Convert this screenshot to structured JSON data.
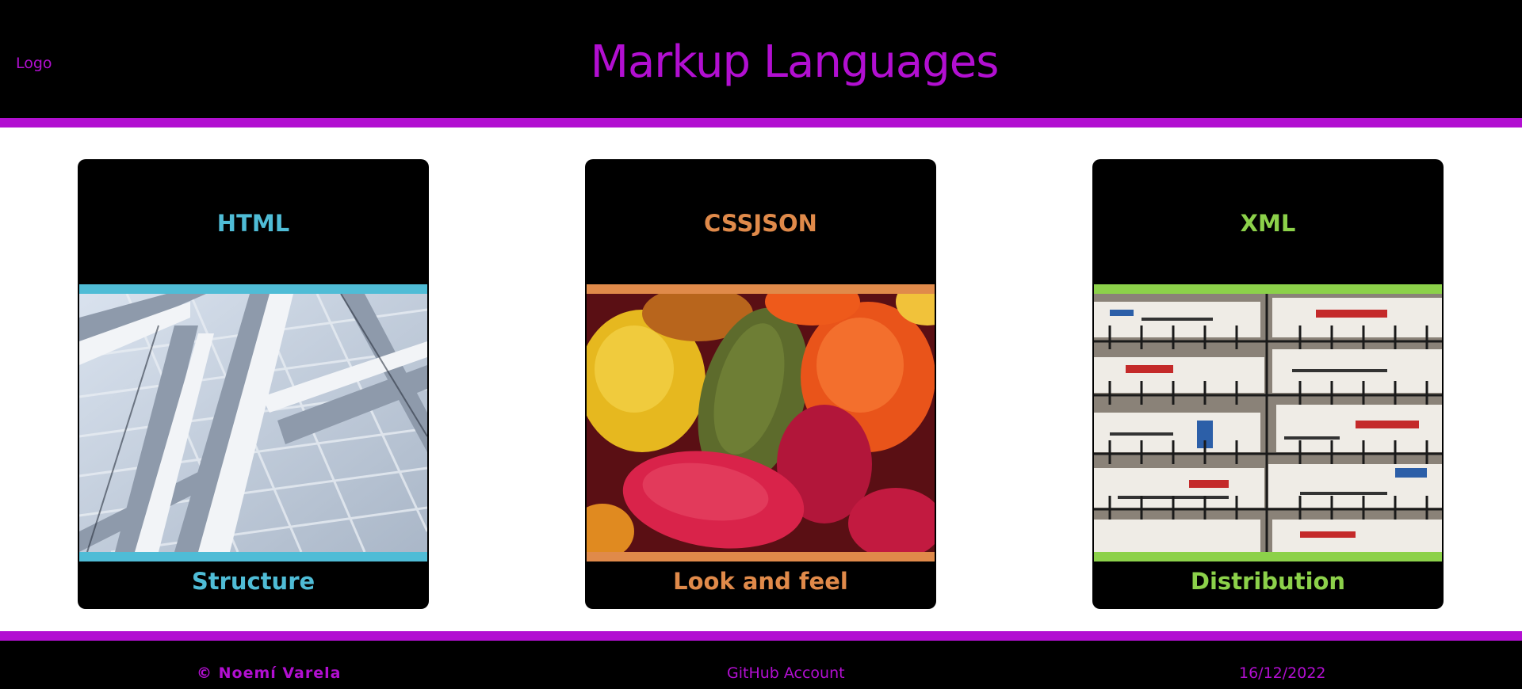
{
  "header": {
    "logo": "Logo",
    "title": "Markup Languages"
  },
  "cards": [
    {
      "title": "HTML",
      "caption": "Structure",
      "accent": "#4fbcd6",
      "image": "steel-architecture-photo"
    },
    {
      "title": "CSSJSON",
      "caption": "Look and feel",
      "accent": "#e08a4a",
      "image": "candy-photo"
    },
    {
      "title": "XML",
      "caption": "Distribution",
      "accent": "#8cd14a",
      "image": "newspaper-rack-photo"
    }
  ],
  "footer": {
    "author": "© Noemí Varela",
    "github": "GitHub Account",
    "date": "16/12/2022"
  },
  "colors": {
    "brand": "#b20fd1",
    "background": "#000000"
  }
}
